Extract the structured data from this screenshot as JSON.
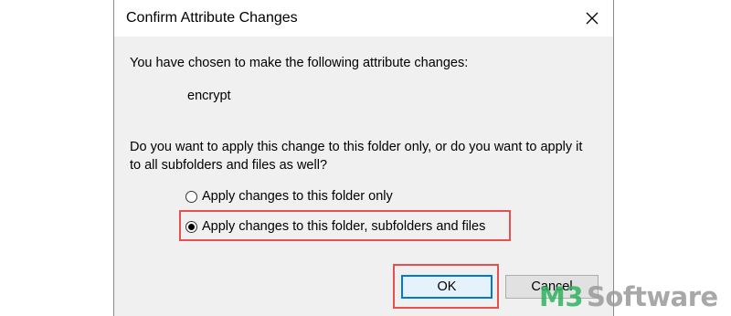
{
  "dialog": {
    "title": "Confirm Attribute Changes",
    "intro": "You have chosen to make the following attribute changes:",
    "attribute": "encrypt",
    "question": "Do you want to apply this change to this folder only, or do you want to apply it to all subfolders and files as well?",
    "options": [
      {
        "label": "Apply changes to this folder only",
        "selected": false
      },
      {
        "label": "Apply changes to this folder, subfolders and files",
        "selected": true
      }
    ],
    "ok_label": "OK",
    "cancel_label": "Cancel",
    "icons": {
      "close": "close-icon"
    }
  },
  "watermark": {
    "brand": "M3",
    "product": "Software",
    "colors": {
      "brand": "#2fb35e",
      "product": "#9a9a9a"
    }
  },
  "colors": {
    "highlight": "#e8504f",
    "accent": "#0078d7",
    "dialog_bg": "#f0f0f0"
  }
}
